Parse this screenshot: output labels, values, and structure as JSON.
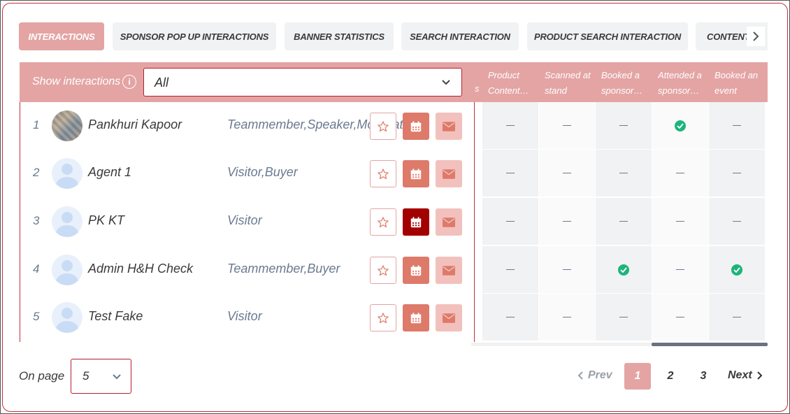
{
  "tabs": [
    {
      "label": "INTERACTIONS",
      "active": true
    },
    {
      "label": "SPONSOR POP UP INTERACTIONS",
      "active": false
    },
    {
      "label": "BANNER STATISTICS",
      "active": false
    },
    {
      "label": "SEARCH INTERACTION",
      "active": false
    },
    {
      "label": "PRODUCT SEARCH INTERACTION",
      "active": false
    },
    {
      "label": "CONTENT",
      "active": false
    }
  ],
  "filter": {
    "label": "Show interactions",
    "selected": "All",
    "info_icon": "info-icon"
  },
  "columns": [
    {
      "line1": "Product",
      "line2": "Content…"
    },
    {
      "line1": "Scanned at",
      "line2": "stand"
    },
    {
      "line1": "Booked a",
      "line2": "sponsore…"
    },
    {
      "line1": "Attended a",
      "line2": "sponsore…"
    },
    {
      "line1": "Booked an",
      "line2": "event"
    }
  ],
  "column_fragment": "s",
  "rows": [
    {
      "num": "1",
      "name": "Pankhuri Kapoor",
      "roles": "Teammember,Speaker,Moderator",
      "avatar": "photo",
      "calendar_state": "normal",
      "cells": [
        "dash",
        "dash",
        "dash",
        "check",
        "dash"
      ]
    },
    {
      "num": "2",
      "name": "Agent 1",
      "roles": "Visitor,Buyer",
      "avatar": "placeholder",
      "calendar_state": "normal",
      "cells": [
        "dash",
        "dash",
        "dash",
        "dash",
        "dash"
      ]
    },
    {
      "num": "3",
      "name": "PK KT",
      "roles": "Visitor",
      "avatar": "placeholder",
      "calendar_state": "active",
      "cells": [
        "dash",
        "dash",
        "dash",
        "dash",
        "dash"
      ]
    },
    {
      "num": "4",
      "name": "Admin H&H Check",
      "roles": "Teammember,Buyer",
      "avatar": "placeholder",
      "calendar_state": "normal",
      "cells": [
        "dash",
        "dash",
        "check",
        "dash",
        "check"
      ]
    },
    {
      "num": "5",
      "name": "Test Fake",
      "roles": "Visitor",
      "avatar": "placeholder",
      "calendar_state": "normal",
      "cells": [
        "dash",
        "dash",
        "dash",
        "dash",
        "dash"
      ]
    }
  ],
  "footer": {
    "on_page_label": "On page",
    "page_size": "5",
    "prev_label": "Prev",
    "next_label": "Next",
    "pages": [
      "1",
      "2",
      "3"
    ],
    "current_page": "1"
  },
  "colors": {
    "accent": "#e4a4a4",
    "border": "#c0303a",
    "calendar": "#de7a6a",
    "calendar_active": "#a30000",
    "mail": "#f2c1bd",
    "check": "#1db47a"
  }
}
